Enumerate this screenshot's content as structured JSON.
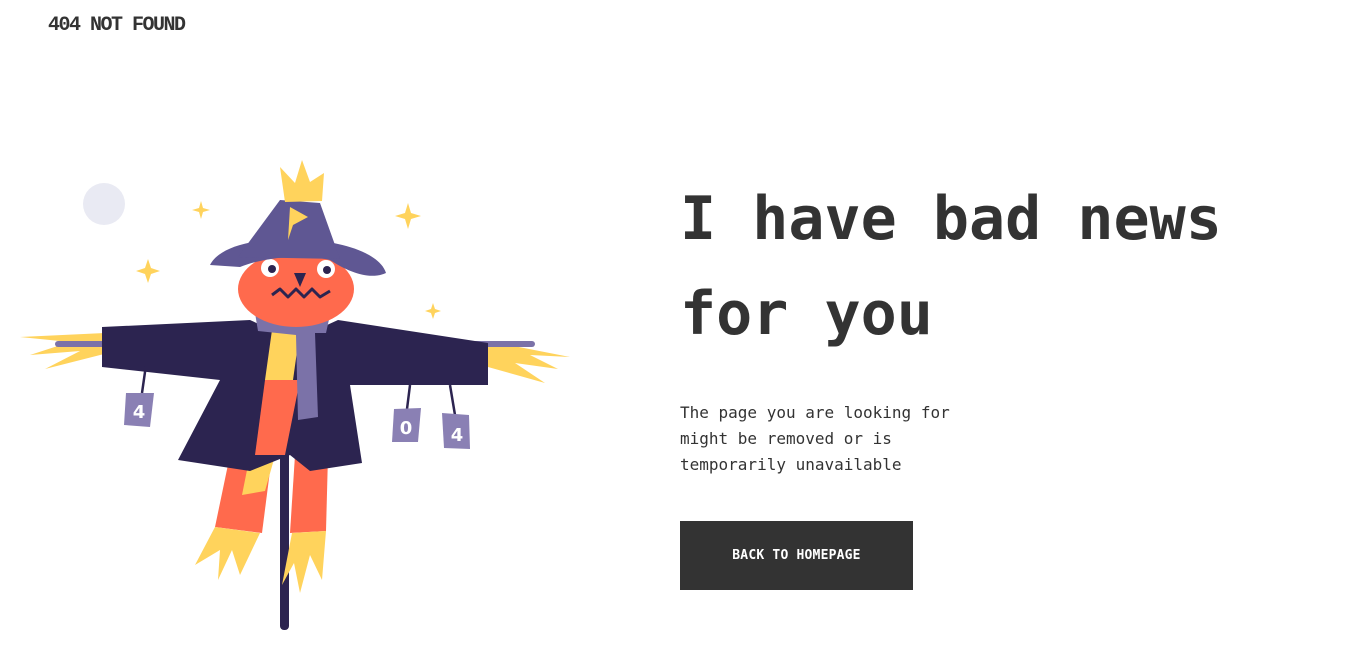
{
  "brand": {
    "label": "404 NOT FOUND"
  },
  "main": {
    "headline": "I have bad news for you",
    "message": "The page you are looking for might be removed or is temporarily unavailable",
    "button_label": "BACK TO HOMEPAGE"
  },
  "illustration": {
    "icon": "scarecrow-illustration",
    "cans": [
      "4",
      "0",
      "4"
    ]
  },
  "colors": {
    "text": "#333333",
    "button_bg": "#333333",
    "button_text": "#ffffff",
    "hat": "#5f5793",
    "face": "#ff6a4d",
    "coat": "#2c2450",
    "straw": "#ffd35c",
    "can": "#8a80b4",
    "moon": "#e9eaf3"
  }
}
